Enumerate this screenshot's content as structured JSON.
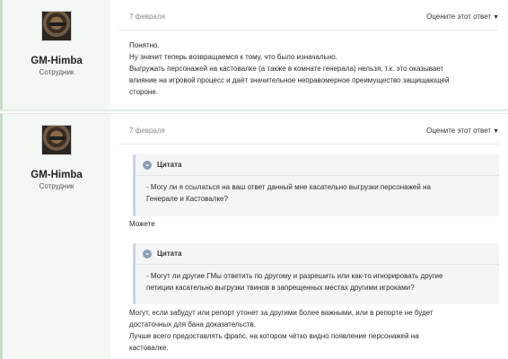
{
  "posts": [
    {
      "author": {
        "name": "GM-Himba",
        "role": "Сотрудник"
      },
      "date": "7 февраля",
      "rate_label": "Оцените этот ответ",
      "body_lines": [
        "Понятно.",
        "Ну значит теперь возвращаемся к тому, что было изначально.",
        "Выгружать персонажей на кастовалке  (а также в комнате генерала) нельзя, т.к. это оказывает",
        "влияние на игровой процесс и даёт значительное неправомерное преимущество защищающей",
        "стороне."
      ]
    },
    {
      "author": {
        "name": "GM-Himba",
        "role": "Сотрудник"
      },
      "date": "7 февраля",
      "rate_label": "Оцените этот ответ",
      "quotes": [
        {
          "title": "Цитата",
          "lines": [
            "- Могу ли я ссылаться на ваш ответ данный мне касательно  выгрузки персонажей на",
            "Генерале и Кастовалке?"
          ]
        },
        {
          "title": "Цитата",
          "lines": [
            "- Могут ли другие ГМы ответить по другому и разрешить или как-то игнорировать другие",
            "петиции касательно выгрузки твинов в запрещенных местах другими игроками?"
          ]
        }
      ],
      "reply1": "Можете",
      "reply2_lines": [
        "Могут, если забудут или репорт утонет за другими более важными, или в репорте не будет",
        "достаточных для бана доказательств.",
        "Лучше всего предоставлять фрапс, на котором чётко видно появление персонажей на",
        "кастовалке."
      ]
    }
  ]
}
